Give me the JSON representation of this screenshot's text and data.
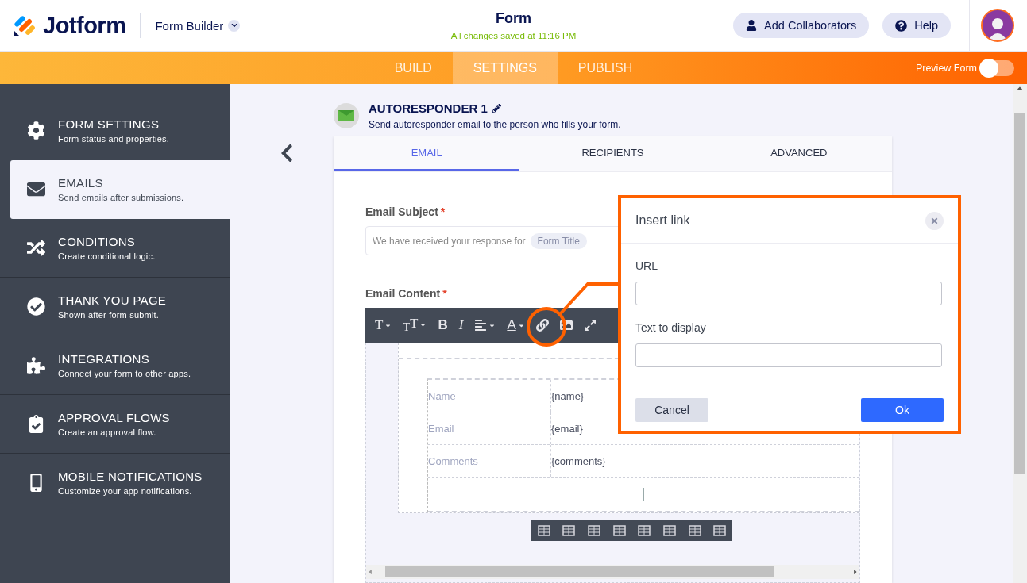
{
  "header": {
    "logo": "Jotform",
    "app_switcher": "Form Builder",
    "title": "Form",
    "save_status": "All changes saved at 11:16 PM",
    "buttons": [
      {
        "label": "Add Collaborators",
        "kind": "collaborators"
      },
      {
        "label": "Help",
        "kind": "help"
      }
    ]
  },
  "nav": {
    "tabs": [
      {
        "label": "BUILD",
        "selected": false
      },
      {
        "label": "SETTINGS",
        "selected": true
      },
      {
        "label": "PUBLISH",
        "selected": false
      }
    ],
    "preview": {
      "label": "Preview Form",
      "on": false
    }
  },
  "sidebar": {
    "items": [
      {
        "title": "FORM SETTINGS",
        "subtitle": "Form status and properties.",
        "selected": false
      },
      {
        "title": "EMAILS",
        "subtitle": "Send emails after submissions.",
        "selected": true
      },
      {
        "title": "CONDITIONS",
        "subtitle": "Create conditional logic.",
        "selected": false
      },
      {
        "title": "THANK YOU PAGE",
        "subtitle": "Shown after form submit.",
        "selected": false
      },
      {
        "title": "INTEGRATIONS",
        "subtitle": "Connect your form to other apps.",
        "selected": false
      },
      {
        "title": "APPROVAL FLOWS",
        "subtitle": "Create an approval flow.",
        "selected": false
      },
      {
        "title": "MOBILE NOTIFICATIONS",
        "subtitle": "Customize your app notifications.",
        "selected": false
      }
    ]
  },
  "autoresponder": {
    "title": "AUTORESPONDER 1",
    "description": "Send autoresponder email to the person who fills your form."
  },
  "email_tabs": [
    {
      "label": "EMAIL",
      "selected": true
    },
    {
      "label": "RECIPIENTS",
      "selected": false
    },
    {
      "label": "ADVANCED",
      "selected": false
    }
  ],
  "subject": {
    "label": "Email Subject",
    "required_mark": "*",
    "text": "We have received your response for",
    "tag": "Form Title"
  },
  "content": {
    "label": "Email Content",
    "required_mark": "*",
    "toolbar": [
      {
        "kind": "glyph",
        "label": "T",
        "dropdown": true
      },
      {
        "kind": "glyph",
        "label": "$_{T}$T",
        "dropdown": true
      },
      {
        "kind": "glyph",
        "label": "B",
        "dropdown": false
      },
      {
        "kind": "glyph",
        "label": "I",
        "dropdown": false
      },
      {
        "kind": "align",
        "dropdown": true
      },
      {
        "kind": "glyph",
        "label": "A",
        "dropdown": true
      },
      {
        "kind": "link",
        "dropdown": false
      },
      {
        "kind": "image",
        "dropdown": false
      },
      {
        "kind": "expand",
        "dropdown": false
      }
    ],
    "rows": [
      {
        "label": "Name",
        "value": "{name}"
      },
      {
        "label": "Email",
        "value": "{email}"
      },
      {
        "label": "Comments",
        "value": "{comments}"
      }
    ]
  },
  "dialog": {
    "title": "Insert link",
    "fields": [
      {
        "label": "URL"
      },
      {
        "label": "Text to display"
      }
    ],
    "buttons": [
      {
        "label": "Cancel",
        "kind": "secondary"
      },
      {
        "label": "Ok",
        "kind": "primary"
      }
    ]
  }
}
